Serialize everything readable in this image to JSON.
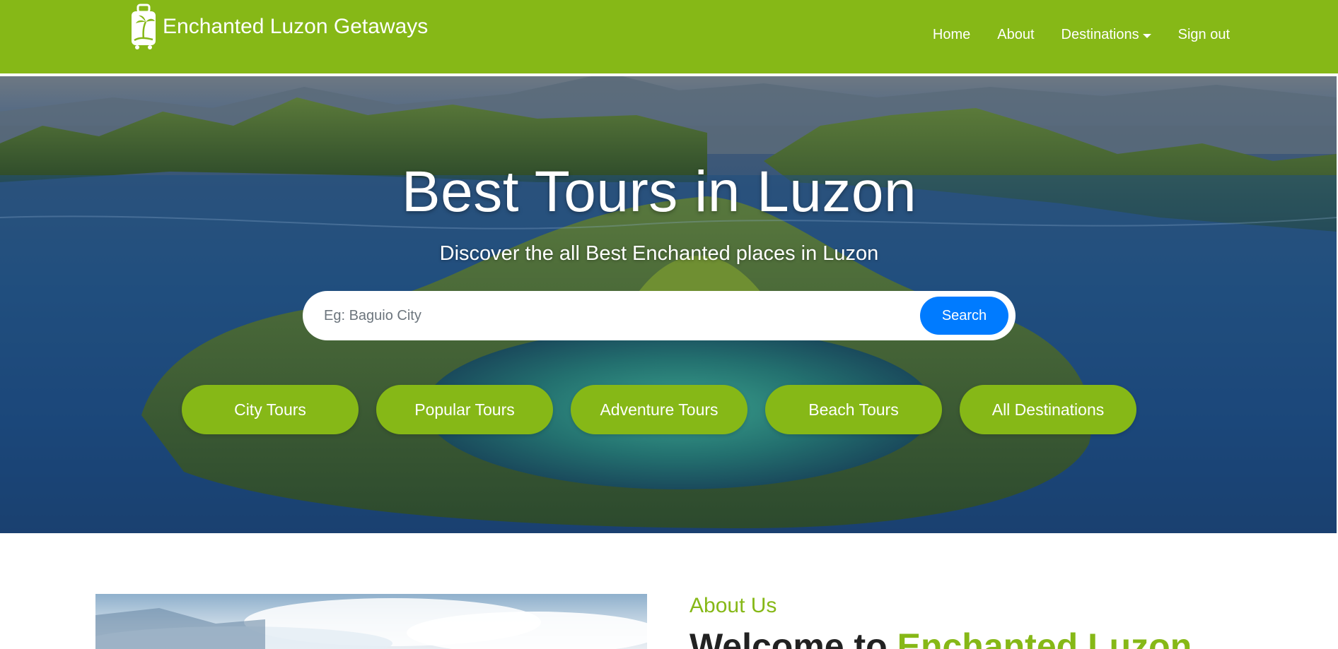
{
  "brand": {
    "name": "Enchanted Luzon Getaways",
    "logo_icon": "luggage-palm-logo"
  },
  "nav": {
    "links": [
      {
        "label": "Home"
      },
      {
        "label": "About"
      },
      {
        "label": "Destinations",
        "dropdown": true
      },
      {
        "label": "Sign out"
      }
    ]
  },
  "hero": {
    "title": "Best Tours in Luzon",
    "subtitle": "Discover the all Best Enchanted places in Luzon",
    "search": {
      "placeholder": "Eg: Baguio City",
      "value": "",
      "button_label": "Search"
    },
    "categories": [
      {
        "label": "City Tours"
      },
      {
        "label": "Popular Tours"
      },
      {
        "label": "Adventure Tours"
      },
      {
        "label": "Beach Tours"
      },
      {
        "label": "All Destinations"
      }
    ]
  },
  "about": {
    "label": "About Us",
    "heading_prefix": "Welcome to ",
    "heading_accent": "Enchanted Luzon"
  },
  "colors": {
    "brand_green": "#86b817",
    "search_blue": "#007bff",
    "text_dark": "#222222"
  }
}
